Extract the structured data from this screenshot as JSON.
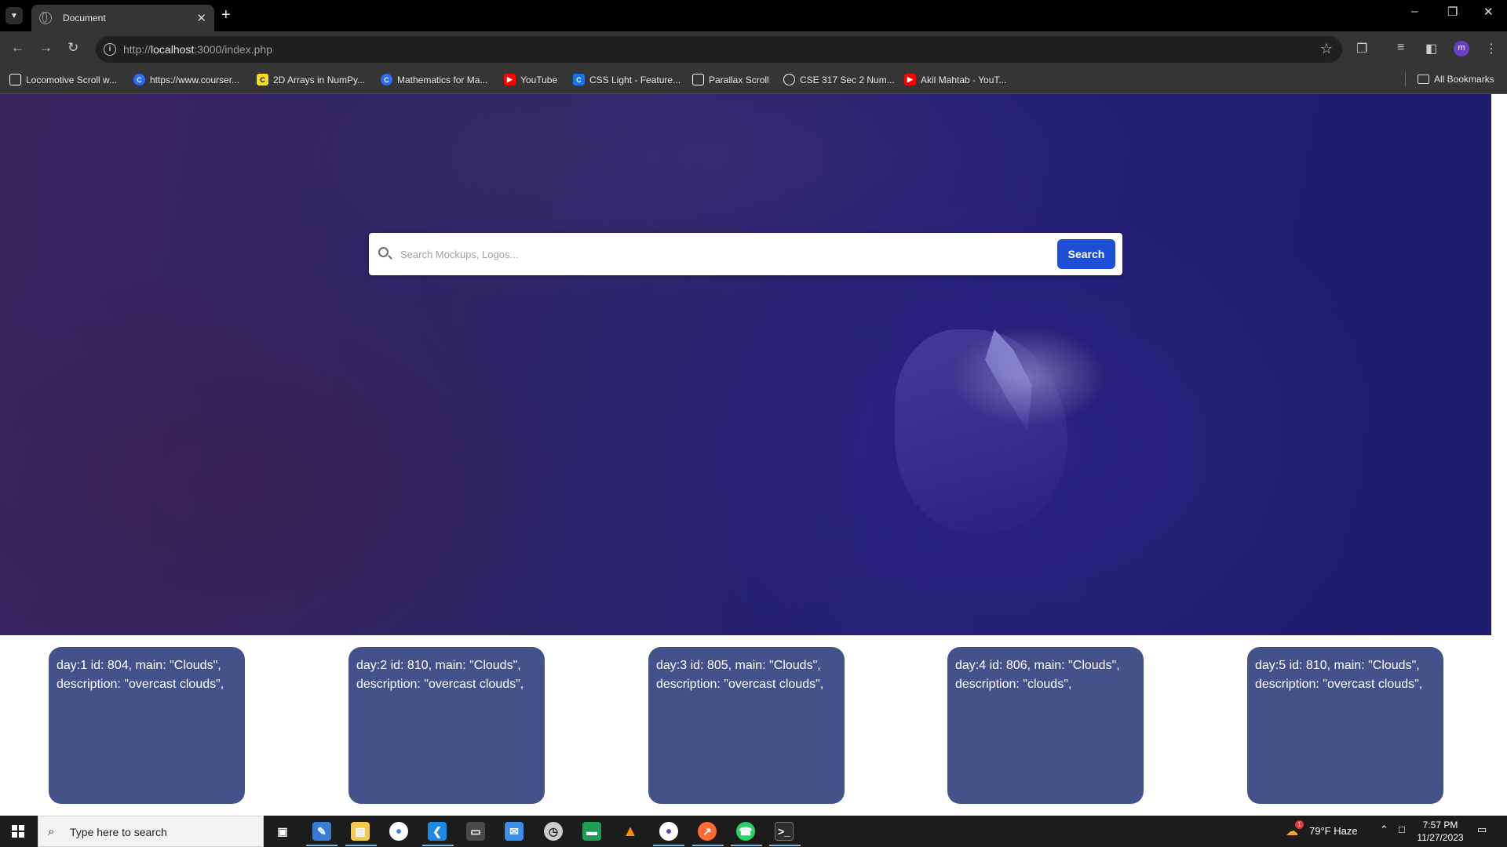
{
  "browser": {
    "tab_title": "Document",
    "url_prefix": "http://",
    "url_host": "localhost",
    "url_rest": ":3000/index.php",
    "bookmarks": [
      {
        "label": "Locomotive Scroll w...",
        "icon_color": "#ffffff"
      },
      {
        "label": "https://www.courser...",
        "icon_color": "#2b6bff"
      },
      {
        "label": "2D Arrays in NumPy...",
        "icon_color": "#f7df1e"
      },
      {
        "label": "Mathematics for Ma...",
        "icon_color": "#2b6bff"
      },
      {
        "label": "YouTube",
        "icon_color": "#ff0000"
      },
      {
        "label": "CSS Light - Feature...",
        "icon_color": "#1a73e8"
      },
      {
        "label": "Parallax Scroll",
        "icon_color": "#ffffff"
      },
      {
        "label": "CSE 317 Sec 2 Num...",
        "icon_color": "#ffffff"
      },
      {
        "label": "Akil Mahtab - YouT...",
        "icon_color": "#ff0000"
      }
    ],
    "all_bookmarks_label": "All Bookmarks",
    "profile_initial": "m"
  },
  "search": {
    "placeholder": "Search Mockups, Logos...",
    "button_label": "Search"
  },
  "forecast_cards": [
    {
      "line1": "day:1 id: 804, main: \"Clouds\",",
      "line2": "description: \"overcast clouds\","
    },
    {
      "line1": "day:2 id: 810, main: \"Clouds\",",
      "line2": "description: \"overcast clouds\","
    },
    {
      "line1": "day:3 id: 805, main: \"Clouds\",",
      "line2": "description: \"overcast clouds\","
    },
    {
      "line1": "day:4 id: 806, main: \"Clouds\",",
      "line2": "description: \"clouds\","
    },
    {
      "line1": "day:5 id: 810, main: \"Clouds\",",
      "line2": "description: \"overcast clouds\","
    }
  ],
  "taskbar": {
    "search_text": "Type here to search",
    "weather": "79°F  Haze",
    "time": "7:57 PM",
    "date": "11/27/2023",
    "weather_badge": "1"
  },
  "colors": {
    "search_button": "#1d4ed8",
    "card_bg": "#43528a",
    "hero_tint": "#241f73"
  }
}
